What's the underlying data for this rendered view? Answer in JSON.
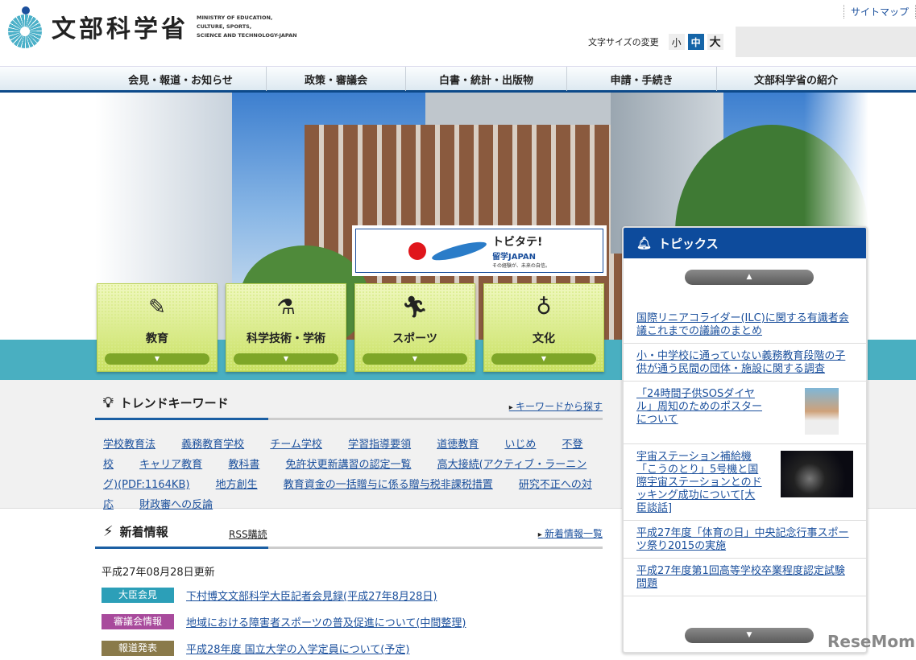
{
  "header": {
    "logo_jp": "文部科学省",
    "logo_en": [
      "MINISTRY OF EDUCATION,",
      "CULTURE, SPORTS,",
      "SCIENCE AND TECHNOLOGY-JAPAN"
    ],
    "sitemap": "サイトマップ",
    "font_size_label": "文字サイズの変更",
    "font_sizes": [
      "小",
      "中",
      "大"
    ]
  },
  "nav": [
    "会見・報道・お知らせ",
    "政策・審議会",
    "白書・統計・出版物",
    "申請・手続き",
    "文部科学省の紹介"
  ],
  "banner": {
    "title": "トビタテ!",
    "subtitle": "留学JAPAN",
    "tagline": "その経験が、未来の自信。"
  },
  "categories": [
    "教育",
    "科学技術・学術",
    "スポーツ",
    "文化"
  ],
  "trend": {
    "title": "トレンドキーワード",
    "more": "キーワードから探す",
    "keywords": [
      "学校教育法",
      "義務教育学校",
      "チーム学校",
      "学習指導要領",
      "道徳教育",
      "いじめ",
      "不登校",
      "キャリア教育",
      "教科書",
      "免許状更新講習の認定一覧",
      "高大接続(アクティブ・ラーニング)(PDF:1164KB)",
      "地方創生",
      "教育資金の一括贈与に係る贈与税非課税措置",
      "研究不正への対応",
      "財政審への反論"
    ]
  },
  "news": {
    "title": "新着情報",
    "rss": "RSS購読",
    "more": "新着情報一覧",
    "updated": "平成27年08月28日更新",
    "items": [
      {
        "badge": "大臣会見",
        "color": "#2c9fb8",
        "text": "下村博文文部科学大臣記者会見録(平成27年8月28日)"
      },
      {
        "badge": "審議会情報",
        "color": "#a84a9c",
        "text": "地域における障害者スポーツの普及促進について(中間整理)"
      },
      {
        "badge": "報道発表",
        "color": "#8a7a4a",
        "text": "平成28年度 国立大学の入学定員について(予定)"
      }
    ]
  },
  "topics": {
    "title": "トピックス",
    "items": [
      "国際リニアコライダー(ILC)に関する有識者会議これまでの議論のまとめ",
      "小・中学校に通っていない義務教育段階の子供が通う民間の団体・施設に関する調査",
      "「24時間子供SOSダイヤル」周知のためのポスターについて",
      "宇宙ステーション補給機「こうのとり」5号機と国際宇宙ステーションとのドッキング成功について[大臣談話]",
      "平成27年度「体育の日」中央記念行事スポーツ祭り2015の実施",
      "平成27年度第1回高等学校卒業程度認定試験問題"
    ]
  },
  "watermark": "ReseMom"
}
